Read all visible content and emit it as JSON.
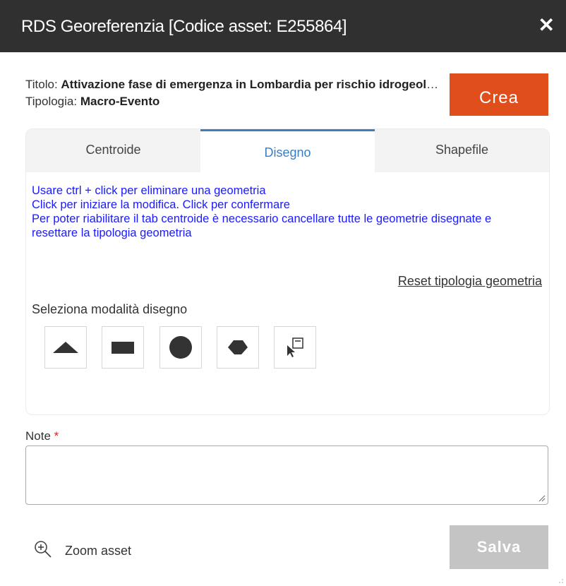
{
  "window": {
    "title": "RDS Georeferenzia [Codice asset: E255864]",
    "close_glyph": "✕"
  },
  "info": {
    "titolo_label": "Titolo:",
    "titolo_value": "Attivazione fase di emergenza in Lombardia per rischio idrogeologico",
    "tipologia_label": "Tipologia:",
    "tipologia_value": "Macro-Evento"
  },
  "actions": {
    "crea_label": "Crea",
    "salva_label": "Salva",
    "zoom_label": "Zoom asset"
  },
  "tabs": [
    {
      "label": "Centroide",
      "active": false
    },
    {
      "label": "Disegno",
      "active": true
    },
    {
      "label": "Shapefile",
      "active": false
    }
  ],
  "instructions": [
    "Usare ctrl + click per eliminare una geometria",
    "Click per iniziare la modifica. Click per confermare",
    "Per poter riabilitare il tab centroide è necessario cancellare tutte le geometrie disegnate e resettare la tipologia geometria"
  ],
  "reset_label": "Reset tipologia geometria",
  "draw_mode": {
    "label": "Seleziona modalità disegno",
    "tools": [
      "triangle-icon",
      "rectangle-icon",
      "circle-icon",
      "polygon-icon",
      "select-edit-icon"
    ]
  },
  "note": {
    "label": "Note",
    "required_marker": "*",
    "value": ""
  },
  "colors": {
    "titlebar": "#303030",
    "accent": "#e04e1c",
    "tab_active": "#3a7fc0",
    "instruction_text": "#1a1aff",
    "disabled": "#c4c4c4"
  }
}
